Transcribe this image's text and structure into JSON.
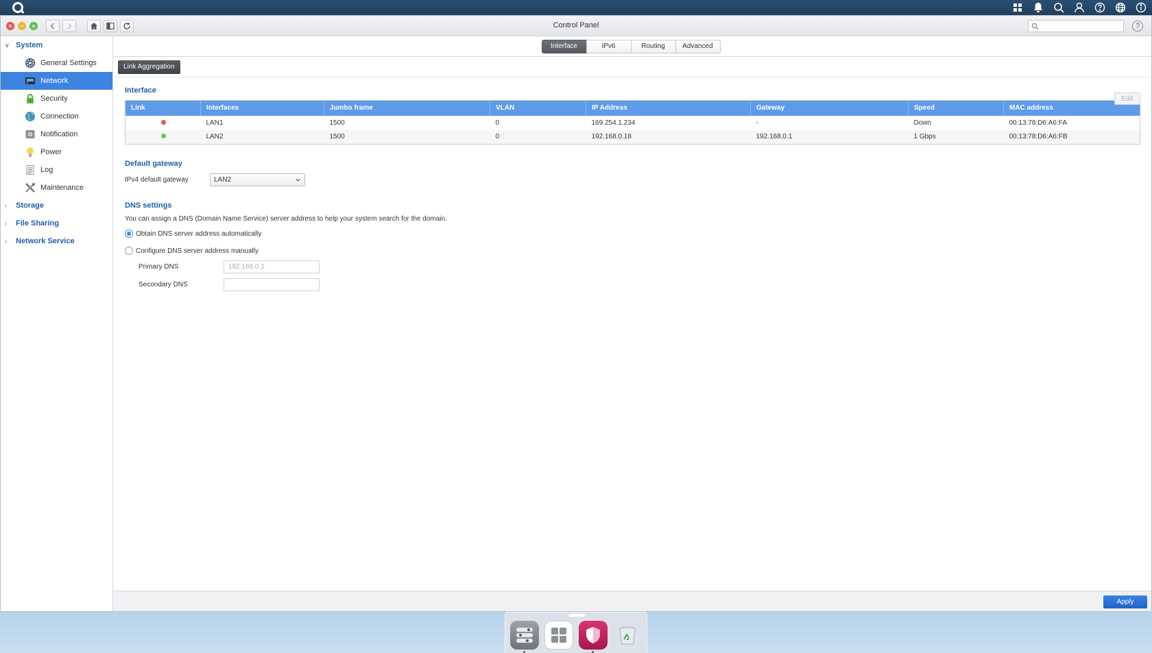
{
  "window": {
    "title": "Control Panel",
    "search_placeholder": ""
  },
  "sidebar": {
    "groups": [
      {
        "label": "System",
        "expanded": true
      },
      {
        "label": "Storage",
        "expanded": false
      },
      {
        "label": "File Sharing",
        "expanded": false
      },
      {
        "label": "Network Service",
        "expanded": false
      }
    ],
    "system_items": [
      {
        "label": "General Settings",
        "icon": "gear-icon"
      },
      {
        "label": "Network",
        "icon": "network-icon",
        "active": true
      },
      {
        "label": "Security",
        "icon": "lock-icon"
      },
      {
        "label": "Connection",
        "icon": "globe-icon"
      },
      {
        "label": "Notification",
        "icon": "notification-icon"
      },
      {
        "label": "Power",
        "icon": "bulb-icon"
      },
      {
        "label": "Log",
        "icon": "log-icon"
      },
      {
        "label": "Maintenance",
        "icon": "tools-icon"
      }
    ]
  },
  "tabs": [
    "Interface",
    "IPv6",
    "Routing",
    "Advanced"
  ],
  "active_tab": "Interface",
  "toolbar": {
    "link_aggregation": "Link Aggregation"
  },
  "interface": {
    "title": "Interface",
    "edit_label": "Edit",
    "columns": [
      "Link",
      "Interfaces",
      "Jumbo frame",
      "VLAN",
      "IP Address",
      "Gateway",
      "Speed",
      "MAC address"
    ],
    "rows": [
      {
        "status": "red",
        "iface": "LAN1",
        "jumbo": "1500",
        "vlan": "0",
        "ip": "169.254.1.234",
        "gateway": "-",
        "speed": "Down",
        "mac": "00:13:78:D6:A6:FA"
      },
      {
        "status": "green",
        "iface": "LAN2",
        "jumbo": "1500",
        "vlan": "0",
        "ip": "192.168.0.18",
        "gateway": "192.168.0.1",
        "speed": "1 Gbps",
        "mac": "00:13:78:D6:A6:FB"
      }
    ]
  },
  "default_gateway": {
    "title": "Default gateway",
    "label": "IPv4 default gateway",
    "value": "LAN2"
  },
  "dns": {
    "title": "DNS settings",
    "description": "You can assign a DNS (Domain Name Service) server address to help your system search for the domain.",
    "auto_label": "Obtain DNS server address automatically",
    "manual_label": "Configure DNS server address manually",
    "primary_label": "Primary DNS",
    "primary_placeholder": "192.168.0.1",
    "secondary_label": "Secondary DNS",
    "secondary_placeholder": ""
  },
  "footer": {
    "apply_label": "Apply"
  },
  "colors": {
    "accent": "#3d84e0",
    "header_blue": "#5e9be8",
    "link_down": "#e8563f",
    "link_up": "#6fc04f"
  }
}
